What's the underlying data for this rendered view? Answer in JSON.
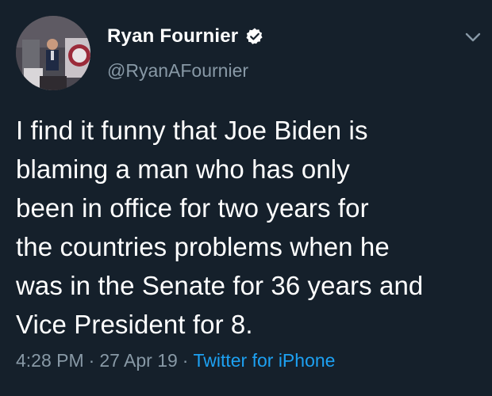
{
  "author": {
    "display_name": "Ryan Fournier",
    "handle": "@RyanAFournier",
    "verified": true
  },
  "tweet": {
    "lines": [
      "I find it funny that Joe Biden is",
      "blaming a man who has only",
      "been in office for two years for",
      "the countries problems when he",
      "was in the Senate for 36 years and",
      "Vice President for 8."
    ],
    "time": "4:28 PM",
    "date": "27 Apr 19",
    "separator": "·",
    "source": "Twitter for iPhone"
  },
  "icons": {
    "verified": "verified-badge-icon",
    "more": "chevron-down-icon"
  },
  "colors": {
    "background": "#15202b",
    "secondary_text": "#8899a6",
    "link": "#1da1f2"
  }
}
